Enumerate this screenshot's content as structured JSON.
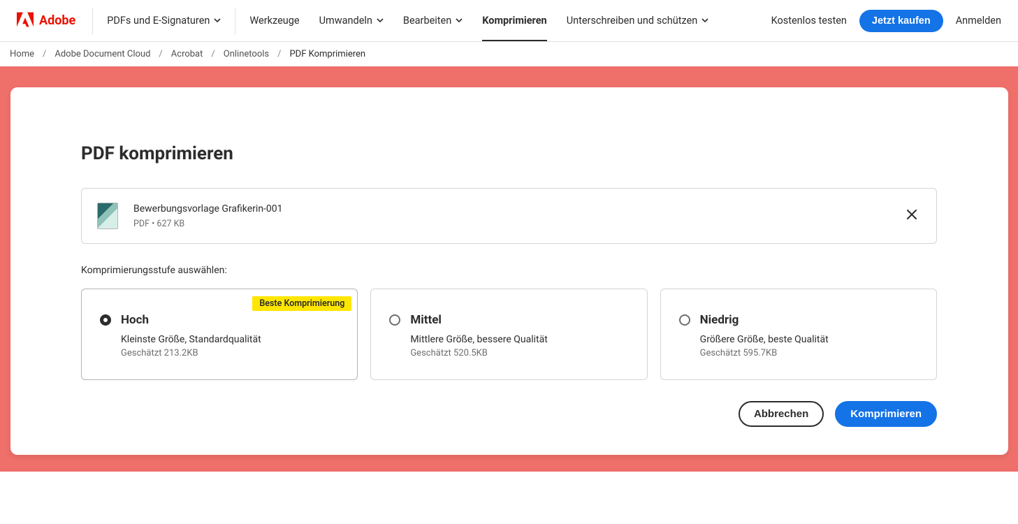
{
  "brand": {
    "name": "Adobe"
  },
  "nav": {
    "items": [
      {
        "label": "PDFs und E-Signaturen",
        "chevron": true,
        "active": false
      },
      {
        "label": "Werkzeuge",
        "chevron": false,
        "active": false
      },
      {
        "label": "Umwandeln",
        "chevron": true,
        "active": false
      },
      {
        "label": "Bearbeiten",
        "chevron": true,
        "active": false
      },
      {
        "label": "Komprimieren",
        "chevron": false,
        "active": true
      },
      {
        "label": "Unterschreiben und schützen",
        "chevron": true,
        "active": false
      }
    ],
    "trial": "Kostenlos testen",
    "buy": "Jetzt kaufen",
    "login": "Anmelden"
  },
  "breadcrumb": {
    "items": [
      "Home",
      "Adobe Document Cloud",
      "Acrobat",
      "Onlinetools"
    ],
    "current": "PDF Komprimieren"
  },
  "page": {
    "title": "PDF komprimieren",
    "file": {
      "name": "Bewerbungsvorlage Grafikerin-001",
      "meta": "PDF • 627 KB"
    },
    "level_label": "Komprimierungsstufe auswählen:",
    "badge": "Beste Komprimierung",
    "options": [
      {
        "title": "Hoch",
        "desc": "Kleinste Größe, Standardqualität",
        "est": "Geschätzt 213.2KB",
        "selected": true
      },
      {
        "title": "Mittel",
        "desc": "Mittlere Größe, bessere Qualität",
        "est": "Geschätzt 520.5KB",
        "selected": false
      },
      {
        "title": "Niedrig",
        "desc": "Größere Größe, beste Qualität",
        "est": "Geschätzt 595.7KB",
        "selected": false
      }
    ],
    "buttons": {
      "cancel": "Abbrechen",
      "submit": "Komprimieren"
    }
  }
}
